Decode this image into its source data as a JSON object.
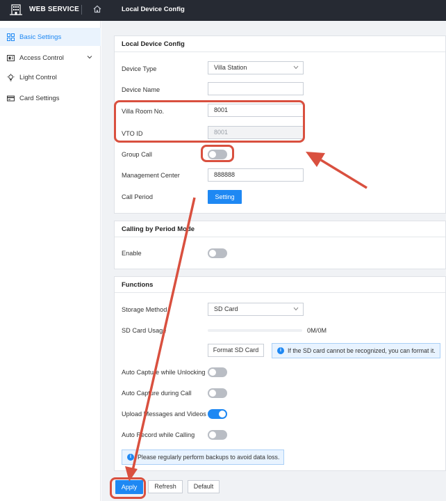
{
  "header": {
    "brand": "WEB SERVICE",
    "breadcrumb": "Local Device Config"
  },
  "sidebar": {
    "items": [
      {
        "label": "Basic Settings",
        "icon": "grid-icon",
        "active": true
      },
      {
        "label": "Access Control",
        "icon": "access-icon",
        "expandable": true
      },
      {
        "label": "Light Control",
        "icon": "bulb-icon"
      },
      {
        "label": "Card Settings",
        "icon": "card-icon"
      }
    ]
  },
  "local_device_config": {
    "title": "Local Device Config",
    "device_type": {
      "label": "Device Type",
      "value": "Villa Station"
    },
    "device_name": {
      "label": "Device Name",
      "value": ""
    },
    "villa_room": {
      "label": "Villa Room No.",
      "value": "8001"
    },
    "vto_id": {
      "label": "VTO ID",
      "value": "8001"
    },
    "group_call": {
      "label": "Group Call",
      "on": false
    },
    "management_center": {
      "label": "Management Center",
      "value": "888888"
    },
    "call_period": {
      "label": "Call Period",
      "button": "Setting"
    }
  },
  "calling_by_period": {
    "title": "Calling by Period Mode",
    "enable": {
      "label": "Enable",
      "on": false
    }
  },
  "functions": {
    "title": "Functions",
    "storage_method": {
      "label": "Storage Method",
      "value": "SD Card"
    },
    "sd_card_usage": {
      "label": "SD Card Usage",
      "value": "0M/0M",
      "fraction": 0
    },
    "format_button": "Format SD Card",
    "format_info": "If the SD card cannot be recognized, you can format it.",
    "auto_capture_unlocking": {
      "label": "Auto Capture while Unlocking",
      "on": false
    },
    "auto_capture_call": {
      "label": "Auto Capture during Call",
      "on": false
    },
    "upload_messages": {
      "label": "Upload Messages and Videos",
      "on": true
    },
    "auto_record": {
      "label": "Auto Record while Calling",
      "on": false
    },
    "backup_info": "Please regularly perform backups to avoid data loss."
  },
  "actions": {
    "apply": "Apply",
    "refresh": "Refresh",
    "default": "Default"
  },
  "colors": {
    "accent": "#1e88f3",
    "annotation": "#d9503f",
    "topbar": "#262a33"
  }
}
